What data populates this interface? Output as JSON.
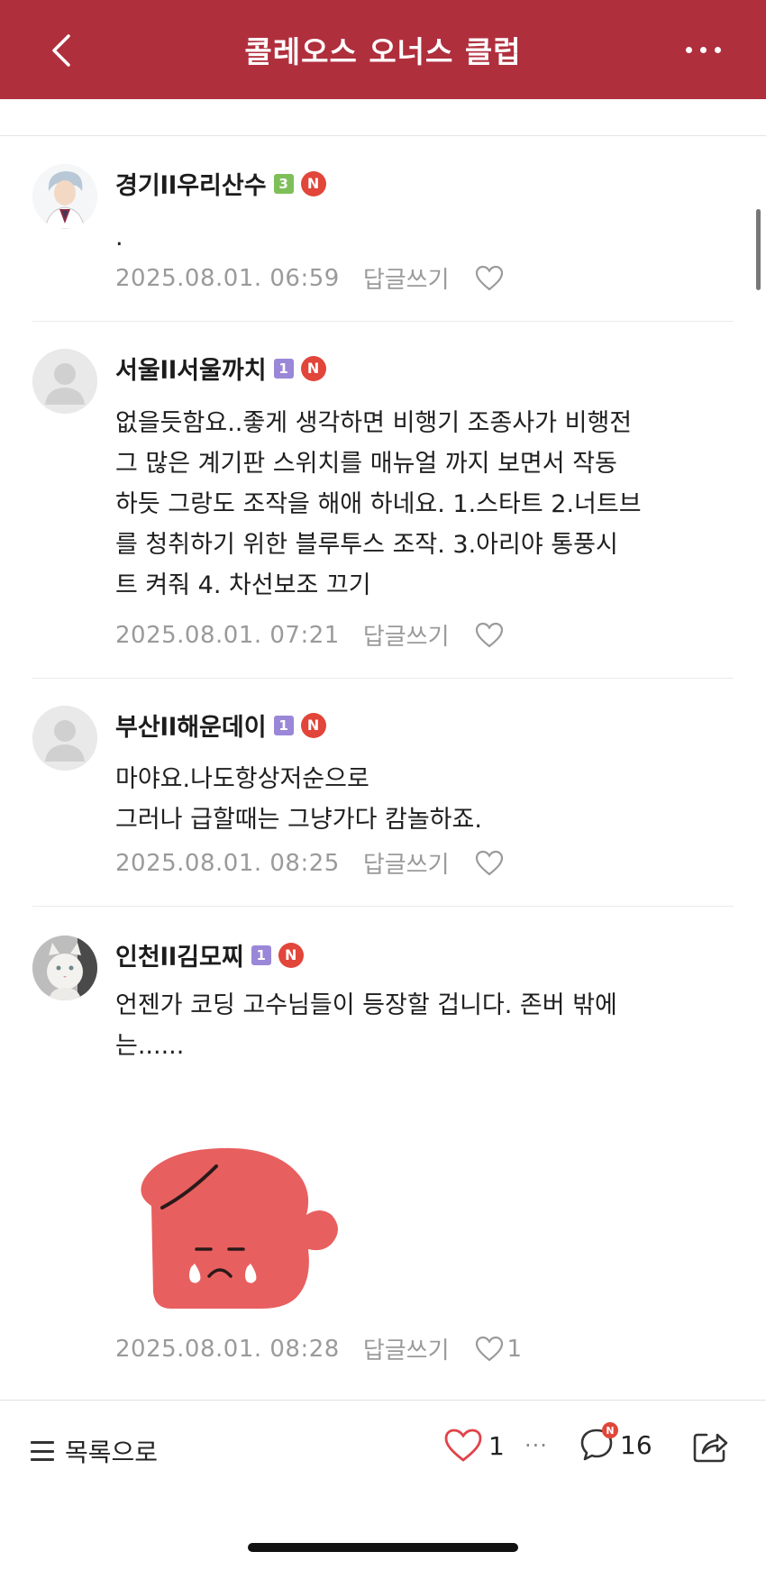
{
  "header": {
    "title": "콜레오스 오너스 클럽",
    "back_icon": "chevron-left-icon",
    "more_icon": "more-dots-icon",
    "background_color": "#b02f3d"
  },
  "comments": [
    {
      "author": "경기ll우리산수",
      "level": "3",
      "level_color": "#7fbf5a",
      "new_badge": "N",
      "text_lines": [
        "."
      ],
      "date": "2025.08.01. 06:59",
      "reply_label": "답글쓰기",
      "like_count": ""
    },
    {
      "author": "서울ll서울까치",
      "level": "1",
      "level_color": "#9a87d8",
      "new_badge": "N",
      "text_lines": [
        "없을듯함요..좋게 생각하면 비행기 조종사가 비행전",
        "그 많은 계기판 스위치를 매뉴얼 까지 보면서 작동",
        "하듯 그랑도 조작을 해애 하네요. 1.스타트 2.너트브",
        "를 청취하기 위한 블루투스 조작. 3.아리야 통풍시",
        "트 켜줘 4. 차선보조 끄기"
      ],
      "date": "2025.08.01. 07:21",
      "reply_label": "답글쓰기",
      "like_count": ""
    },
    {
      "author": "부산ll해운데이",
      "level": "1",
      "level_color": "#9a87d8",
      "new_badge": "N",
      "text_lines": [
        "마야요.나도항상저순으로",
        "그러나 급할때는 그냥가다 캄놀하죠."
      ],
      "date": "2025.08.01. 08:25",
      "reply_label": "답글쓰기",
      "like_count": ""
    },
    {
      "author": "인천ll김모찌",
      "level": "1",
      "level_color": "#9a87d8",
      "new_badge": "N",
      "text_lines": [
        "언젠가 코딩 고수님들이 등장할 겁니다. 존버 밖에",
        "는......"
      ],
      "sticker": "crying-blob-sticker",
      "date": "2025.08.01. 08:28",
      "reply_label": "답글쓰기",
      "like_count": "1"
    }
  ],
  "bottom_bar": {
    "list_label": "목록으로",
    "like_count": "1",
    "more_dots": "···",
    "comment_count": "16",
    "comment_new_badge": "N",
    "share_icon": "share-icon"
  }
}
